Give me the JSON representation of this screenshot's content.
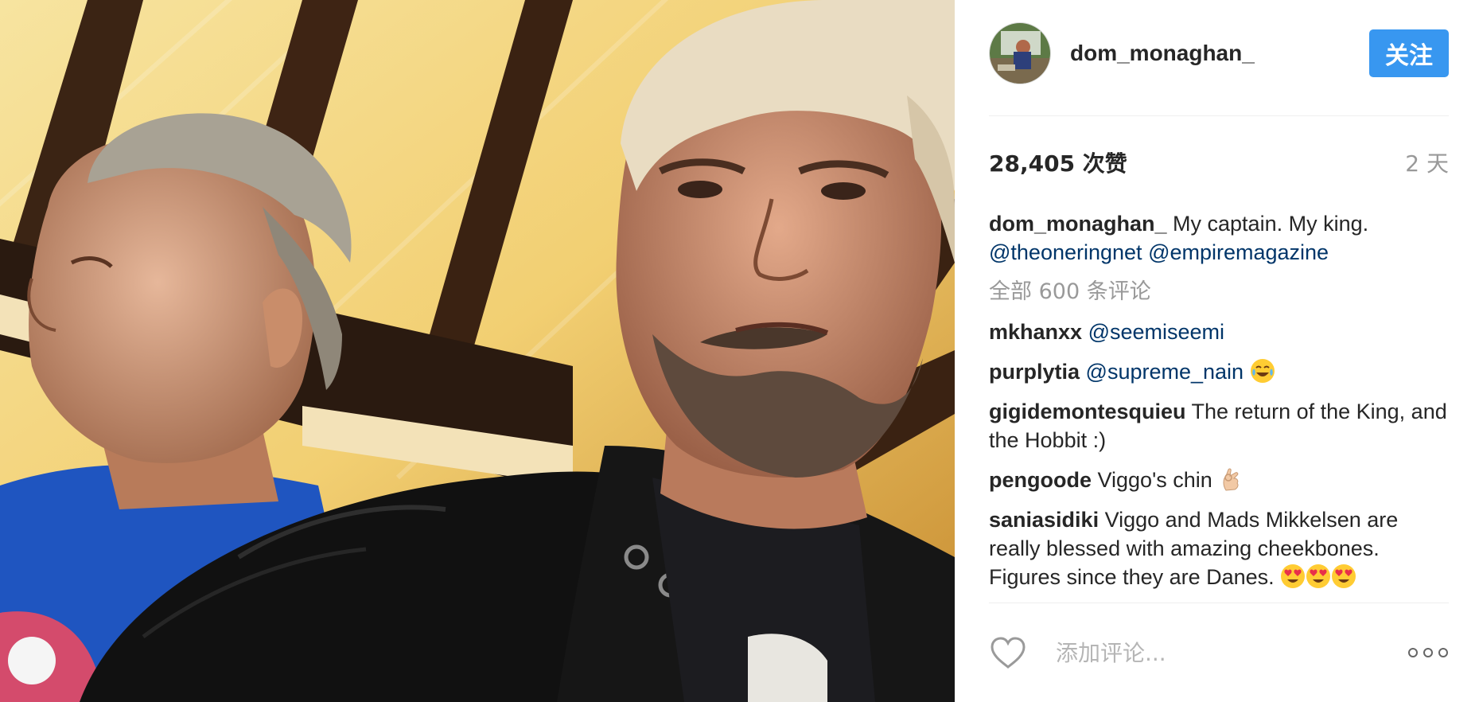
{
  "post": {
    "username": "dom_monaghan_",
    "follow_label": "关注",
    "likes": "28,405 次赞",
    "time": "2 天",
    "caption": {
      "user": "dom_monaghan_",
      "text": " My captain. My king. ",
      "mention1": "@theoneringnet",
      "mention2": "@empiremagazine"
    },
    "view_all": "全部 600 条评论",
    "comments": [
      {
        "user": "mkhanxx",
        "text": " ",
        "mention": "@seemiseemi",
        "after": ""
      },
      {
        "user": "purplytia",
        "text": " ",
        "mention": "@supreme_nain",
        "after": " ",
        "emoji": "tears-of-joy-emoji"
      },
      {
        "user": "gigidemontesquieu",
        "text": " The return of the King, and the Hobbit :)"
      },
      {
        "user": "pengoode",
        "text": " Viggo's chin ",
        "emoji": "ok-hand-emoji"
      },
      {
        "user": "saniasidiki",
        "text": " Viggo and Mads Mikkelsen are really blessed with amazing cheekbones. Figures since they are Danes. ",
        "emoji": "heart-eyes-emoji"
      }
    ],
    "add_comment_placeholder": "添加评论..."
  },
  "icons": {
    "heart": "heart-icon",
    "more": "more-options-icon",
    "avatar": "avatar"
  },
  "colors": {
    "follow_button": "#3897f0",
    "mention": "#003569",
    "muted": "#999999",
    "text": "#262626"
  }
}
